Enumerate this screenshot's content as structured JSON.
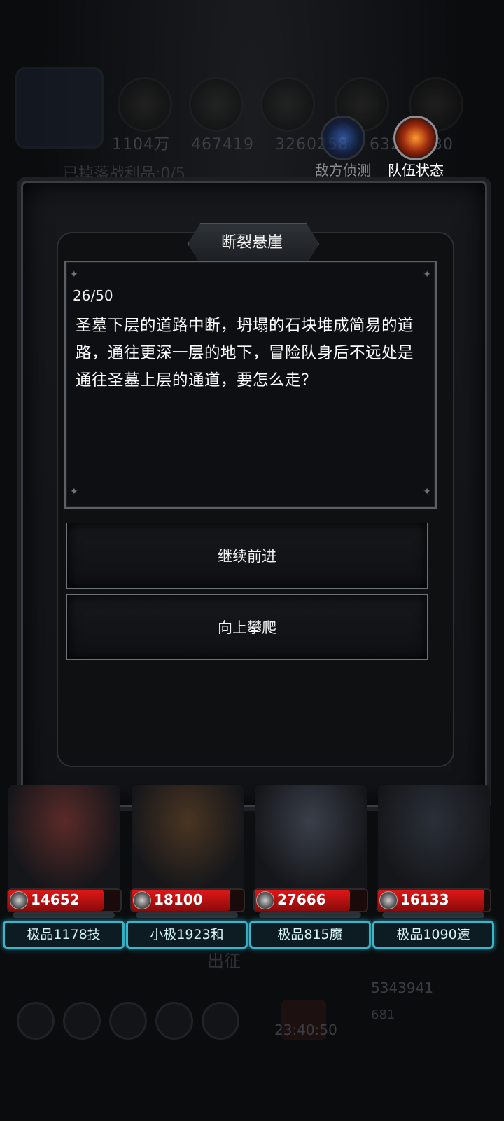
{
  "background": {
    "stats": [
      "1104万",
      "467419",
      "3260258",
      "632",
      "630"
    ],
    "loot_text": "已掉落战利品:0/5",
    "deploy_text": "出征",
    "timer": "23:40:50",
    "coins": "5343941",
    "gems": "681"
  },
  "top_buttons": {
    "scout_label": "敌方侦测",
    "team_label": "队伍状态"
  },
  "dialog": {
    "title": "断裂悬崖",
    "progress": "26/50",
    "story": "圣墓下层的道路中断，坍塌的石块堆成简易的道路，通往更深一层的地下，冒险队身后不远处是通往圣墓上层的通道，要怎么走？",
    "choices": [
      "继续前进",
      "向上攀爬"
    ]
  },
  "heroes": [
    {
      "hp": "14652",
      "hp_fraction": 0.85,
      "tag": "极品1178技",
      "color": "#5a2a28"
    },
    {
      "hp": "18100",
      "hp_fraction": 0.88,
      "tag": "小极1923和",
      "color": "#4a3522"
    },
    {
      "hp": "27666",
      "hp_fraction": 0.85,
      "tag": "极品815魔",
      "color": "#3a3f4a"
    },
    {
      "hp": "16133",
      "hp_fraction": 0.95,
      "tag": "极品1090速",
      "color": "#2a3038"
    }
  ],
  "colors": {
    "hp_red": "#e01717",
    "tag_cyan": "#3ab6c9",
    "frame": "#3a3d43"
  }
}
